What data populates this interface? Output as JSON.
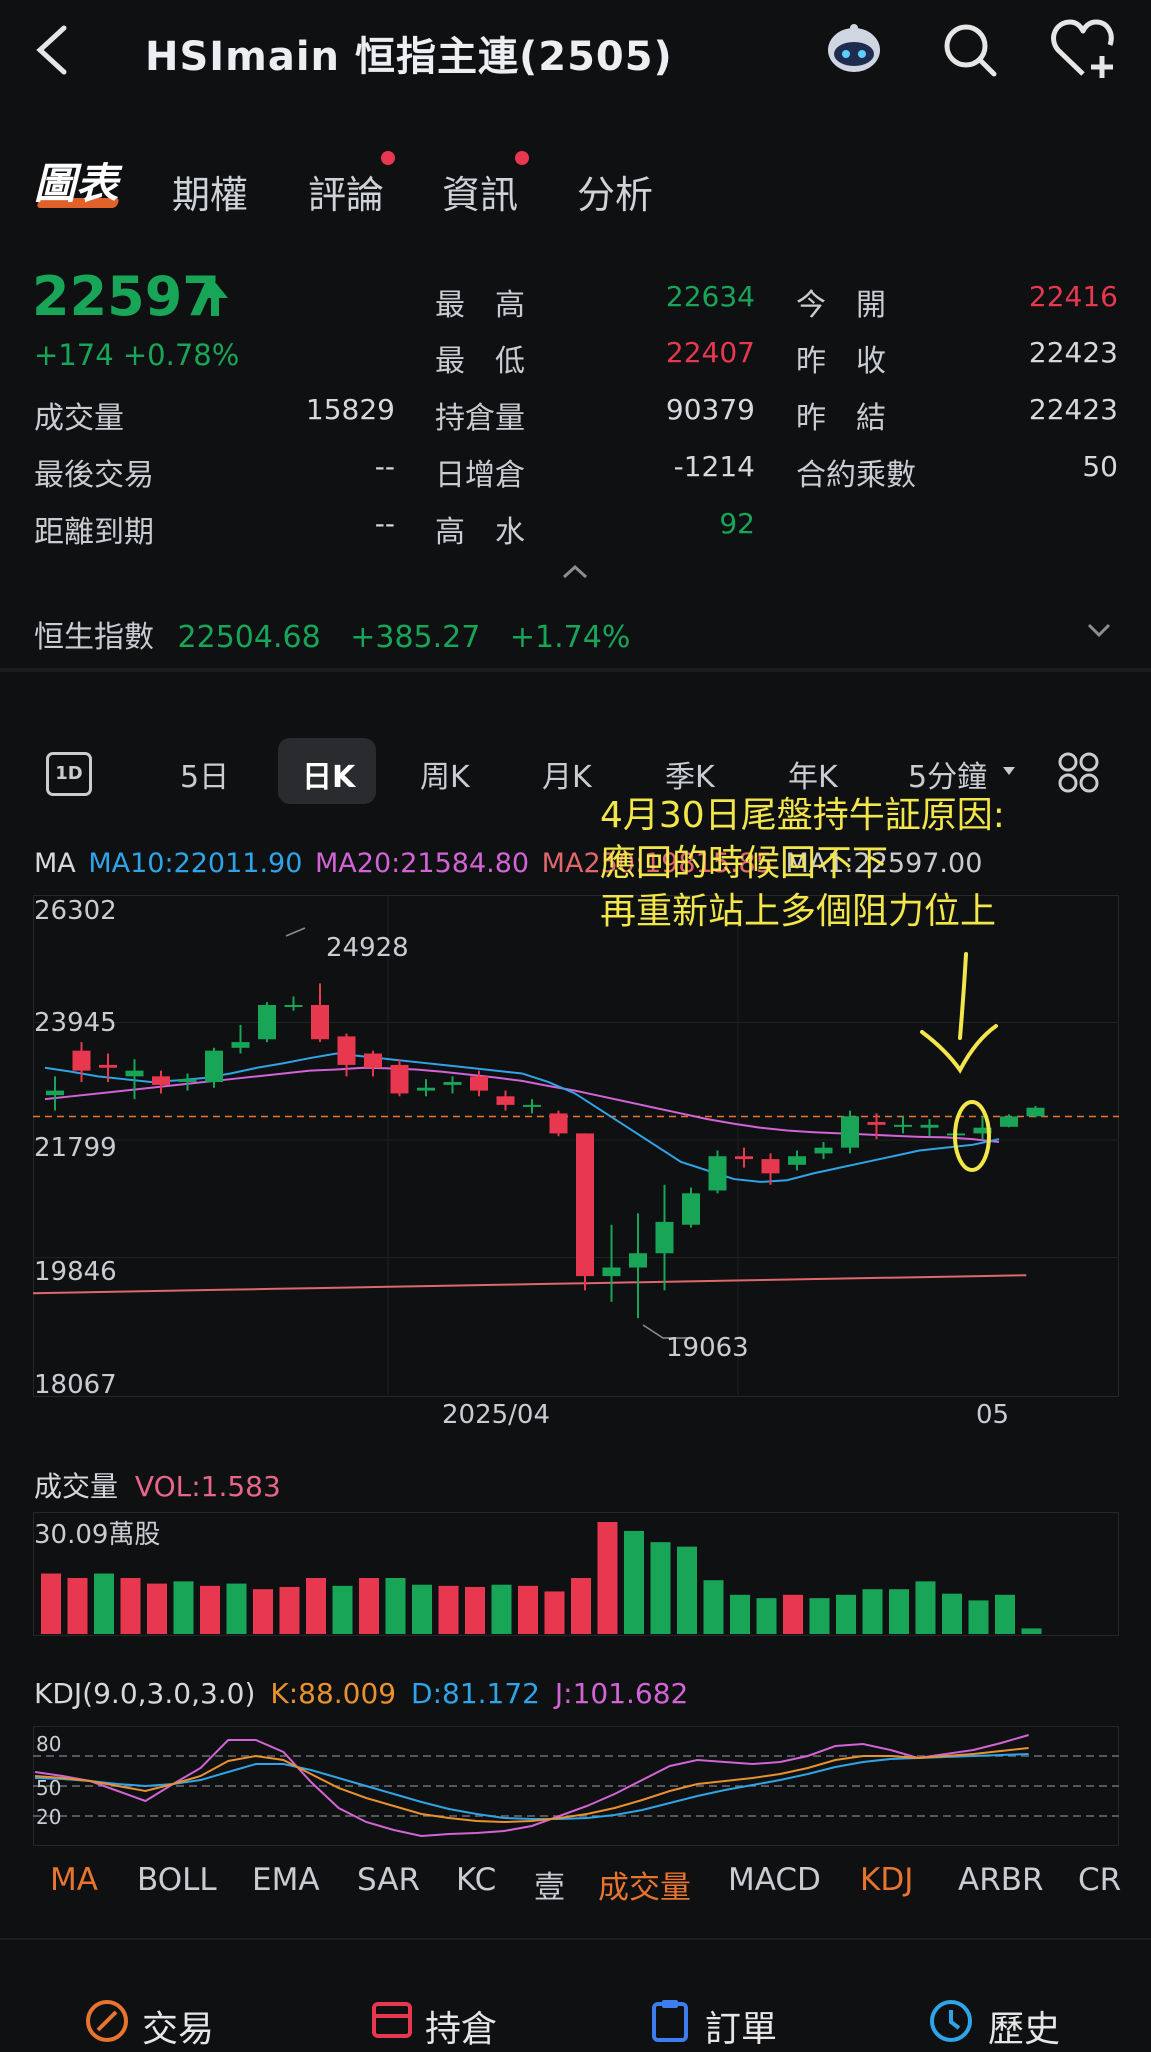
{
  "header": {
    "title": "HSImain  恒指主連(2505)"
  },
  "tabs": [
    {
      "label": "圖表",
      "active": true,
      "dot": false
    },
    {
      "label": "期權",
      "active": false,
      "dot": false
    },
    {
      "label": "評論",
      "active": false,
      "dot": true
    },
    {
      "label": "資訊",
      "active": false,
      "dot": true
    },
    {
      "label": "分析",
      "active": false,
      "dot": false
    }
  ],
  "quote": {
    "price": "22597",
    "change": "+174  +0.78%",
    "volume_label": "成交量",
    "volume_value": "15829",
    "last_trade_label": "最後交易",
    "last_trade_value": "--",
    "expiry_label": "距離到期",
    "expiry_value": "--",
    "high_label": "最　高",
    "high_value": "22634",
    "low_label": "最　低",
    "low_value": "22407",
    "oi_label": "持倉量",
    "oi_value": "90379",
    "oi_change_label": "日增倉",
    "oi_change_value": "-1214",
    "premium_label": "高　水",
    "premium_value": "92",
    "open_label": "今　開",
    "open_value": "22416",
    "prev_close_label": "昨　收",
    "prev_close_value": "22423",
    "prev_settle_label": "昨　結",
    "prev_settle_value": "22423",
    "multiplier_label": "合約乘數",
    "multiplier_value": "50"
  },
  "hsi": {
    "label": "恒生指數",
    "value": "22504.68",
    "change": "+385.27",
    "pct": "+1.74%"
  },
  "periods": [
    "5日",
    "日K",
    "周K",
    "月K",
    "季K",
    "年K",
    "5分鐘"
  ],
  "oneday_icon_text": "1D",
  "ma_legend": {
    "ma": "MA",
    "ma10": "MA10:22011.90",
    "ma20": "MA20:21584.80",
    "ma250": "MA250:19815.85",
    "ma1": "MA1:22597.00"
  },
  "chart_data": {
    "type": "candlestick",
    "y_ticks": [
      "26302",
      "23945",
      "21799",
      "19846",
      "18067"
    ],
    "x_ticks": [
      "2025/04",
      "05"
    ],
    "annotations": [
      "24928",
      "19063"
    ],
    "ylim": [
      18067,
      26302
    ],
    "candles": [
      {
        "o": 22970,
        "c": 23050,
        "h": 23300,
        "l": 22700
      },
      {
        "o": 23750,
        "c": 23400,
        "h": 23900,
        "l": 23200
      },
      {
        "o": 23500,
        "c": 23450,
        "h": 23700,
        "l": 23200
      },
      {
        "o": 23300,
        "c": 23400,
        "h": 23600,
        "l": 22900
      },
      {
        "o": 23300,
        "c": 23150,
        "h": 23400,
        "l": 23000
      },
      {
        "o": 23200,
        "c": 23250,
        "h": 23350,
        "l": 23050
      },
      {
        "o": 23200,
        "c": 23750,
        "h": 23800,
        "l": 23100
      },
      {
        "o": 23800,
        "c": 23900,
        "h": 24200,
        "l": 23700
      },
      {
        "o": 23950,
        "c": 24550,
        "h": 24600,
        "l": 23900
      },
      {
        "o": 24550,
        "c": 24550,
        "h": 24700,
        "l": 24450
      },
      {
        "o": 24550,
        "c": 23950,
        "h": 24928,
        "l": 23900
      },
      {
        "o": 24000,
        "c": 23500,
        "h": 24050,
        "l": 23300
      },
      {
        "o": 23700,
        "c": 23450,
        "h": 23750,
        "l": 23300
      },
      {
        "o": 23500,
        "c": 23000,
        "h": 23600,
        "l": 22950
      },
      {
        "o": 23050,
        "c": 23100,
        "h": 23250,
        "l": 22950
      },
      {
        "o": 23150,
        "c": 23200,
        "h": 23300,
        "l": 23000
      },
      {
        "o": 23300,
        "c": 23050,
        "h": 23400,
        "l": 22950
      },
      {
        "o": 22950,
        "c": 22800,
        "h": 23050,
        "l": 22700
      },
      {
        "o": 22800,
        "c": 22800,
        "h": 22900,
        "l": 22650
      },
      {
        "o": 22650,
        "c": 22300,
        "h": 22700,
        "l": 22250
      },
      {
        "o": 22300,
        "c": 19800,
        "h": 22300,
        "l": 19550
      },
      {
        "o": 19800,
        "c": 19950,
        "h": 20700,
        "l": 19350
      },
      {
        "o": 19950,
        "c": 20200,
        "h": 20900,
        "l": 19063
      },
      {
        "o": 20200,
        "c": 20750,
        "h": 21400,
        "l": 19550
      },
      {
        "o": 20700,
        "c": 21250,
        "h": 21350,
        "l": 20650
      },
      {
        "o": 21300,
        "c": 21900,
        "h": 22000,
        "l": 21250
      },
      {
        "o": 21900,
        "c": 21850,
        "h": 22050,
        "l": 21700
      },
      {
        "o": 21850,
        "c": 21600,
        "h": 21950,
        "l": 21400
      },
      {
        "o": 21750,
        "c": 21900,
        "h": 22000,
        "l": 21650
      },
      {
        "o": 21950,
        "c": 22050,
        "h": 22150,
        "l": 21850
      },
      {
        "o": 22050,
        "c": 22600,
        "h": 22700,
        "l": 21950
      },
      {
        "o": 22500,
        "c": 22450,
        "h": 22650,
        "l": 22200
      },
      {
        "o": 22450,
        "c": 22450,
        "h": 22600,
        "l": 22300
      },
      {
        "o": 22400,
        "c": 22450,
        "h": 22550,
        "l": 22250
      },
      {
        "o": 22300,
        "c": 22300,
        "h": 22400,
        "l": 22150
      },
      {
        "o": 22300,
        "c": 22400,
        "h": 22600,
        "l": 22200
      },
      {
        "o": 22416,
        "c": 22597,
        "h": 22634,
        "l": 22407
      },
      {
        "o": 22600,
        "c": 22750,
        "h": 22780,
        "l": 22580
      }
    ],
    "ma10": [
      23450,
      23380,
      23300,
      23250,
      23200,
      23230,
      23270,
      23350,
      23450,
      23530,
      23620,
      23700,
      23650,
      23600,
      23550,
      23500,
      23450,
      23400,
      23350,
      23200,
      23000,
      22700,
      22400,
      22100,
      21800,
      21650,
      21500,
      21450,
      21480,
      21600,
      21700,
      21800,
      21900,
      22000,
      22050,
      22100,
      22200
    ],
    "ma20": [
      22900,
      22950,
      23000,
      23050,
      23100,
      23150,
      23200,
      23250,
      23300,
      23350,
      23400,
      23420,
      23450,
      23440,
      23420,
      23380,
      23330,
      23280,
      23220,
      23130,
      23050,
      22950,
      22850,
      22750,
      22650,
      22550,
      22470,
      22400,
      22350,
      22320,
      22300,
      22280,
      22260,
      22240,
      22230,
      22200,
      22150
    ],
    "ma250": [
      19500,
      19515,
      19530,
      19545,
      19560,
      19575,
      19590,
      19605,
      19620,
      19635,
      19650,
      19665,
      19680,
      19695,
      19710,
      19725,
      19740,
      19755,
      19770,
      19785,
      19800,
      19815
    ]
  },
  "volume": {
    "label": "成交量",
    "vol_value": "VOL:1.583",
    "scale_label": "30.09萬股",
    "bars": [
      0.54,
      0.5,
      0.54,
      0.5,
      0.45,
      0.47,
      0.43,
      0.45,
      0.4,
      0.42,
      0.5,
      0.43,
      0.5,
      0.5,
      0.44,
      0.43,
      0.42,
      0.44,
      0.43,
      0.38,
      0.5,
      1.0,
      0.92,
      0.82,
      0.78,
      0.48,
      0.35,
      0.32,
      0.35,
      0.32,
      0.35,
      0.4,
      0.4,
      0.47,
      0.36,
      0.3,
      0.35,
      0.05
    ],
    "colors": [
      "r",
      "r",
      "g",
      "r",
      "r",
      "g",
      "r",
      "g",
      "r",
      "r",
      "r",
      "g",
      "r",
      "g",
      "g",
      "r",
      "r",
      "g",
      "r",
      "r",
      "r",
      "r",
      "g",
      "g",
      "g",
      "g",
      "g",
      "g",
      "r",
      "g",
      "g",
      "g",
      "g",
      "g",
      "g",
      "g",
      "g",
      "g"
    ]
  },
  "kdj": {
    "params": "KDJ(9.0,3.0,3.0)",
    "k": "K:88.009",
    "d": "D:81.172",
    "j": "J:101.682",
    "levels": [
      "80",
      "50",
      "20"
    ],
    "k_series": [
      60,
      58,
      55,
      50,
      45,
      52,
      60,
      75,
      80,
      76,
      62,
      48,
      38,
      30,
      22,
      18,
      15,
      14,
      15,
      18,
      22,
      28,
      36,
      45,
      52,
      55,
      58,
      62,
      68,
      76,
      80,
      80,
      78,
      80,
      82,
      85,
      88
    ],
    "d_series": [
      58,
      57,
      55,
      52,
      50,
      52,
      56,
      64,
      72,
      72,
      66,
      58,
      50,
      42,
      34,
      27,
      22,
      18,
      17,
      17,
      18,
      21,
      26,
      33,
      40,
      46,
      51,
      56,
      62,
      69,
      74,
      77,
      78,
      79,
      80,
      81,
      82
    ],
    "j_series": [
      64,
      60,
      55,
      45,
      35,
      52,
      68,
      96,
      96,
      84,
      54,
      28,
      14,
      6,
      0,
      2,
      3,
      5,
      10,
      20,
      30,
      42,
      56,
      70,
      76,
      74,
      72,
      74,
      80,
      90,
      92,
      86,
      78,
      82,
      86,
      93,
      101
    ]
  },
  "indicators": [
    {
      "label": "MA",
      "active": true
    },
    {
      "label": "BOLL",
      "active": false
    },
    {
      "label": "EMA",
      "active": false
    },
    {
      "label": "SAR",
      "active": false
    },
    {
      "label": "KC",
      "active": false
    },
    {
      "label": "壹",
      "active": false
    },
    {
      "label": "成交量",
      "active": true
    },
    {
      "label": "MACD",
      "active": false
    },
    {
      "label": "KDJ",
      "active": true
    },
    {
      "label": "ARBR",
      "active": false
    },
    {
      "label": "CR",
      "active": false
    }
  ],
  "bottom_nav": [
    "交易",
    "持倉",
    "訂單",
    "歷史"
  ],
  "annotation": {
    "line1": "4月30日尾盤持牛証原因:",
    "line2": "應回的時候回不下",
    "line3": "再重新站上多個阻力位上"
  },
  "colors": {
    "up": "#18a558",
    "down": "#e8384f",
    "accent": "#e8752f",
    "annot": "#f2e64a"
  }
}
